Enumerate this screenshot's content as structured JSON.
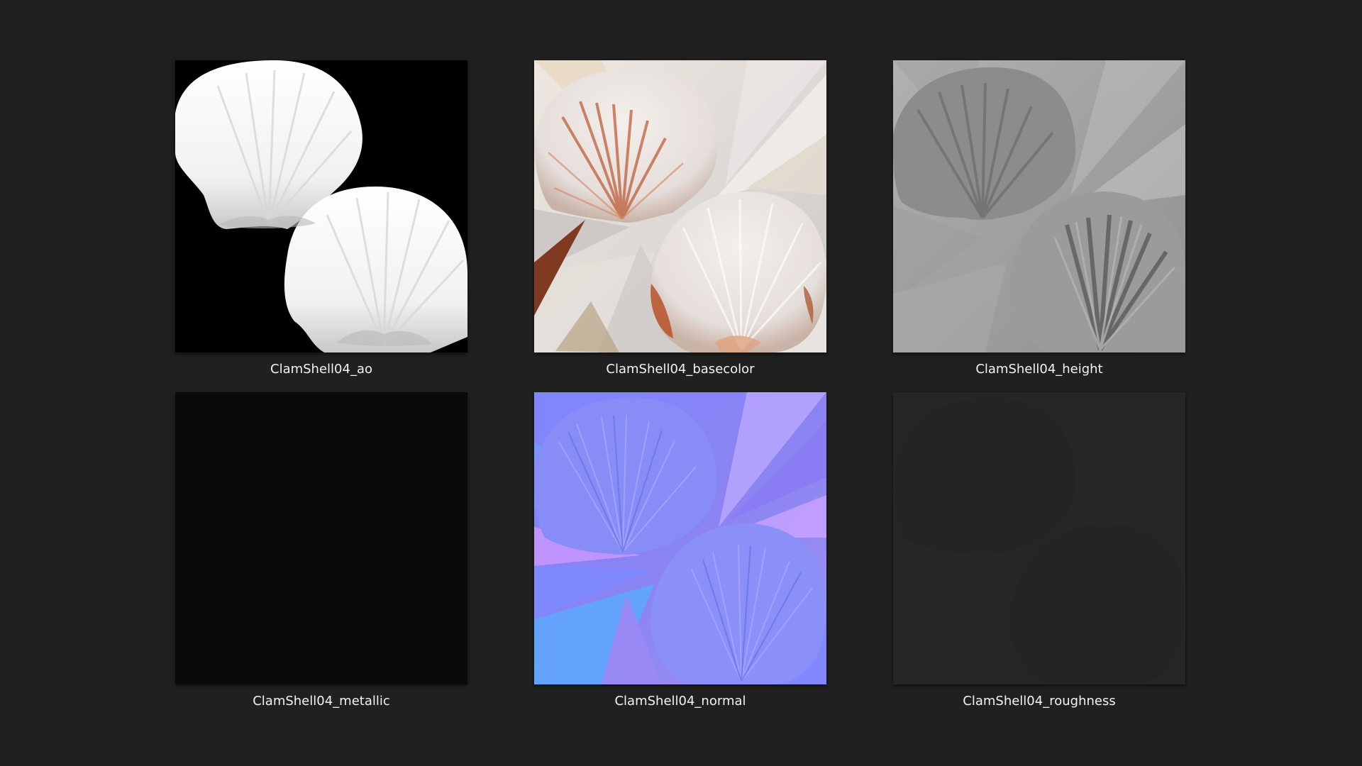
{
  "background_color": "#202020",
  "files": [
    {
      "id": "ao",
      "name": "ClamShell04_ao",
      "icon": "ambient-occlusion-map-thumbnail"
    },
    {
      "id": "basecolor",
      "name": "ClamShell04_basecolor",
      "icon": "base-color-map-thumbnail"
    },
    {
      "id": "height",
      "name": "ClamShell04_height",
      "icon": "height-map-thumbnail"
    },
    {
      "id": "metallic",
      "name": "ClamShell04_metallic",
      "icon": "metallic-map-thumbnail"
    },
    {
      "id": "normal",
      "name": "ClamShell04_normal",
      "icon": "normal-map-thumbnail"
    },
    {
      "id": "roughness",
      "name": "ClamShell04_roughness",
      "icon": "roughness-map-thumbnail"
    }
  ]
}
